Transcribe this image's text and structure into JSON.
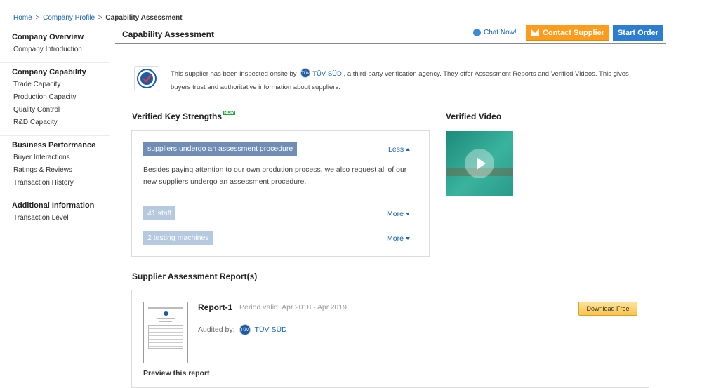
{
  "breadcrumb": {
    "home": "Home",
    "company_profile": "Company Profile",
    "current": "Capability Assessment",
    "separator": ">"
  },
  "sidebar": {
    "groups": [
      {
        "title": "Company Overview",
        "items": [
          "Company Introduction"
        ]
      },
      {
        "title": "Company Capability",
        "items": [
          "Trade Capacity",
          "Production Capacity",
          "Quality Control",
          "R&D Capacity"
        ]
      },
      {
        "title": "Business Performance",
        "items": [
          "Buyer Interactions",
          "Ratings & Reviews",
          "Transaction History"
        ]
      },
      {
        "title": "Additional Information",
        "items": [
          "Transaction Level"
        ]
      }
    ]
  },
  "header": {
    "title": "Capability Assessment",
    "chat_label": "Chat Now!",
    "contact_label": "Contact Supplier",
    "start_order_label": "Start Order"
  },
  "intro": {
    "text_before": "This supplier has been inspected onsite by",
    "agency": "TÜV SÜD",
    "text_after": ", a third-party verification agency. They offer Assessment Reports and Verified Videos. This gives buyers trust and authoritative information about suppliers.",
    "tuv_icon_text": "TÜV"
  },
  "key_strengths": {
    "title": "Verified Key Strengths",
    "new_badge": "NEW",
    "items": [
      {
        "label": "suppliers undergo an assessment procedure",
        "toggle": "Less",
        "expanded": true,
        "description": "Besides paying attention to our own prodution process, we also request all of our new suppliers undergo an assessment procedure."
      },
      {
        "label": "41 staff",
        "toggle": "More",
        "expanded": false
      },
      {
        "label": "2 testing machines",
        "toggle": "More",
        "expanded": false
      }
    ]
  },
  "verified_video": {
    "title": "Verified Video"
  },
  "reports": {
    "title": "Supplier Assessment Report(s)",
    "items": [
      {
        "name": "Report-1",
        "period": "Period valid: Apr.2018 - Apr.2019",
        "audited_by_label": "Audited by:",
        "auditor": "TÜV SÜD",
        "download_label": "Download Free",
        "preview_label": "Preview this report"
      }
    ]
  },
  "colors": {
    "link": "#1a66b3",
    "contact_button": "#ff9c1c",
    "start_order_button": "#2d7dd1",
    "tag_dark": "#6f8db5",
    "tag_light": "#b7c9df",
    "new_badge": "#1ea83c"
  }
}
